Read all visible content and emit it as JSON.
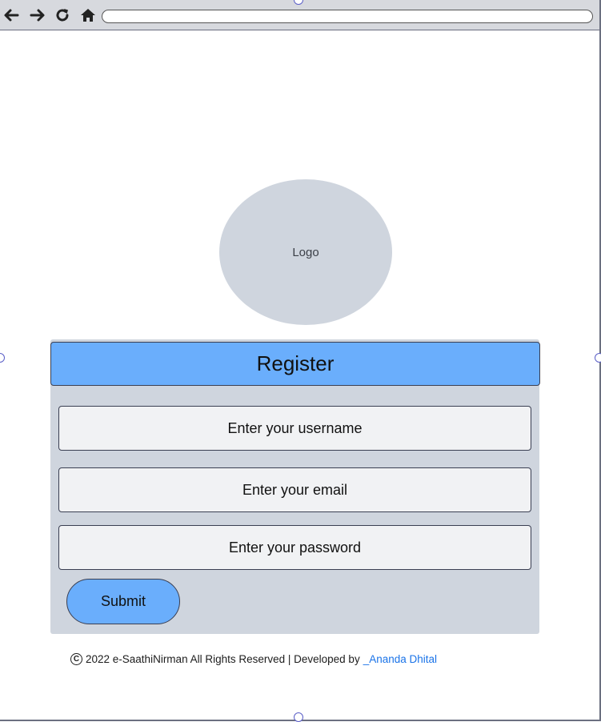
{
  "browser": {
    "back_icon": "arrow-left-icon",
    "forward_icon": "arrow-right-icon",
    "reload_icon": "reload-icon",
    "home_icon": "home-icon",
    "address_value": ""
  },
  "logo": {
    "label": "Logo"
  },
  "form": {
    "title": "Register",
    "username_placeholder": "Enter your username",
    "email_placeholder": "Enter your email",
    "password_placeholder": "Enter your password",
    "submit_label": "Submit"
  },
  "footer": {
    "copyright_symbol": "C",
    "text": "2022 e-SaathiNirman All Rights Reserved | Developed by",
    "developer_link": "_Ananda Dhital"
  },
  "colors": {
    "accent": "#6aaefc",
    "panel": "#cfd5de",
    "field_bg": "#f1f2f4",
    "link": "#1a73e8",
    "border": "#3a3f52"
  }
}
